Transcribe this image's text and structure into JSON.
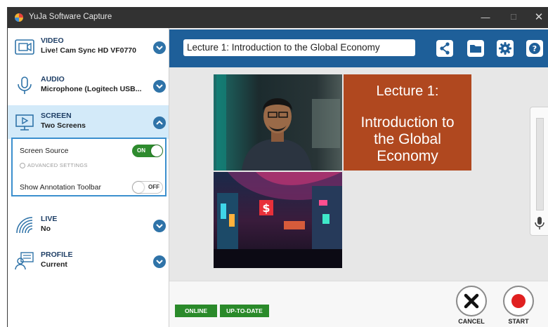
{
  "window": {
    "title": "YuJa Software Capture"
  },
  "sidebar": {
    "sections": [
      {
        "title": "VIDEO",
        "value": "Live! Cam Sync HD VF0770",
        "icon": "camera-icon"
      },
      {
        "title": "AUDIO",
        "value": "Microphone (Logitech USB...",
        "icon": "microphone-icon"
      },
      {
        "title": "SCREEN",
        "value": "Two Screens",
        "icon": "screen-icon"
      },
      {
        "title": "LIVE",
        "value": "No",
        "icon": "broadcast-icon"
      },
      {
        "title": "PROFILE",
        "value": "Current",
        "icon": "profile-icon"
      }
    ],
    "screen_panel": {
      "screen_source_label": "Screen Source",
      "screen_source_toggle": "ON",
      "advanced_settings": "ADVANCED SETTINGS",
      "annotation_label": "Show Annotation Toolbar",
      "annotation_toggle": "OFF"
    }
  },
  "header": {
    "session_title": "Lecture 1: Introduction to the Global Economy",
    "tools": [
      "share-icon",
      "folder-icon",
      "gear-icon",
      "help-icon"
    ]
  },
  "slide": {
    "line1": "Lecture 1:",
    "line2": "Introduction to the Global Economy"
  },
  "status": {
    "online": "ONLINE",
    "update": "UP-TO-DATE"
  },
  "actions": {
    "cancel": "CANCEL",
    "start": "START"
  },
  "colors": {
    "accent": "#1e5f99",
    "slide": "#b0481f",
    "status_green": "#2a8a2a",
    "record_red": "#e02020"
  }
}
